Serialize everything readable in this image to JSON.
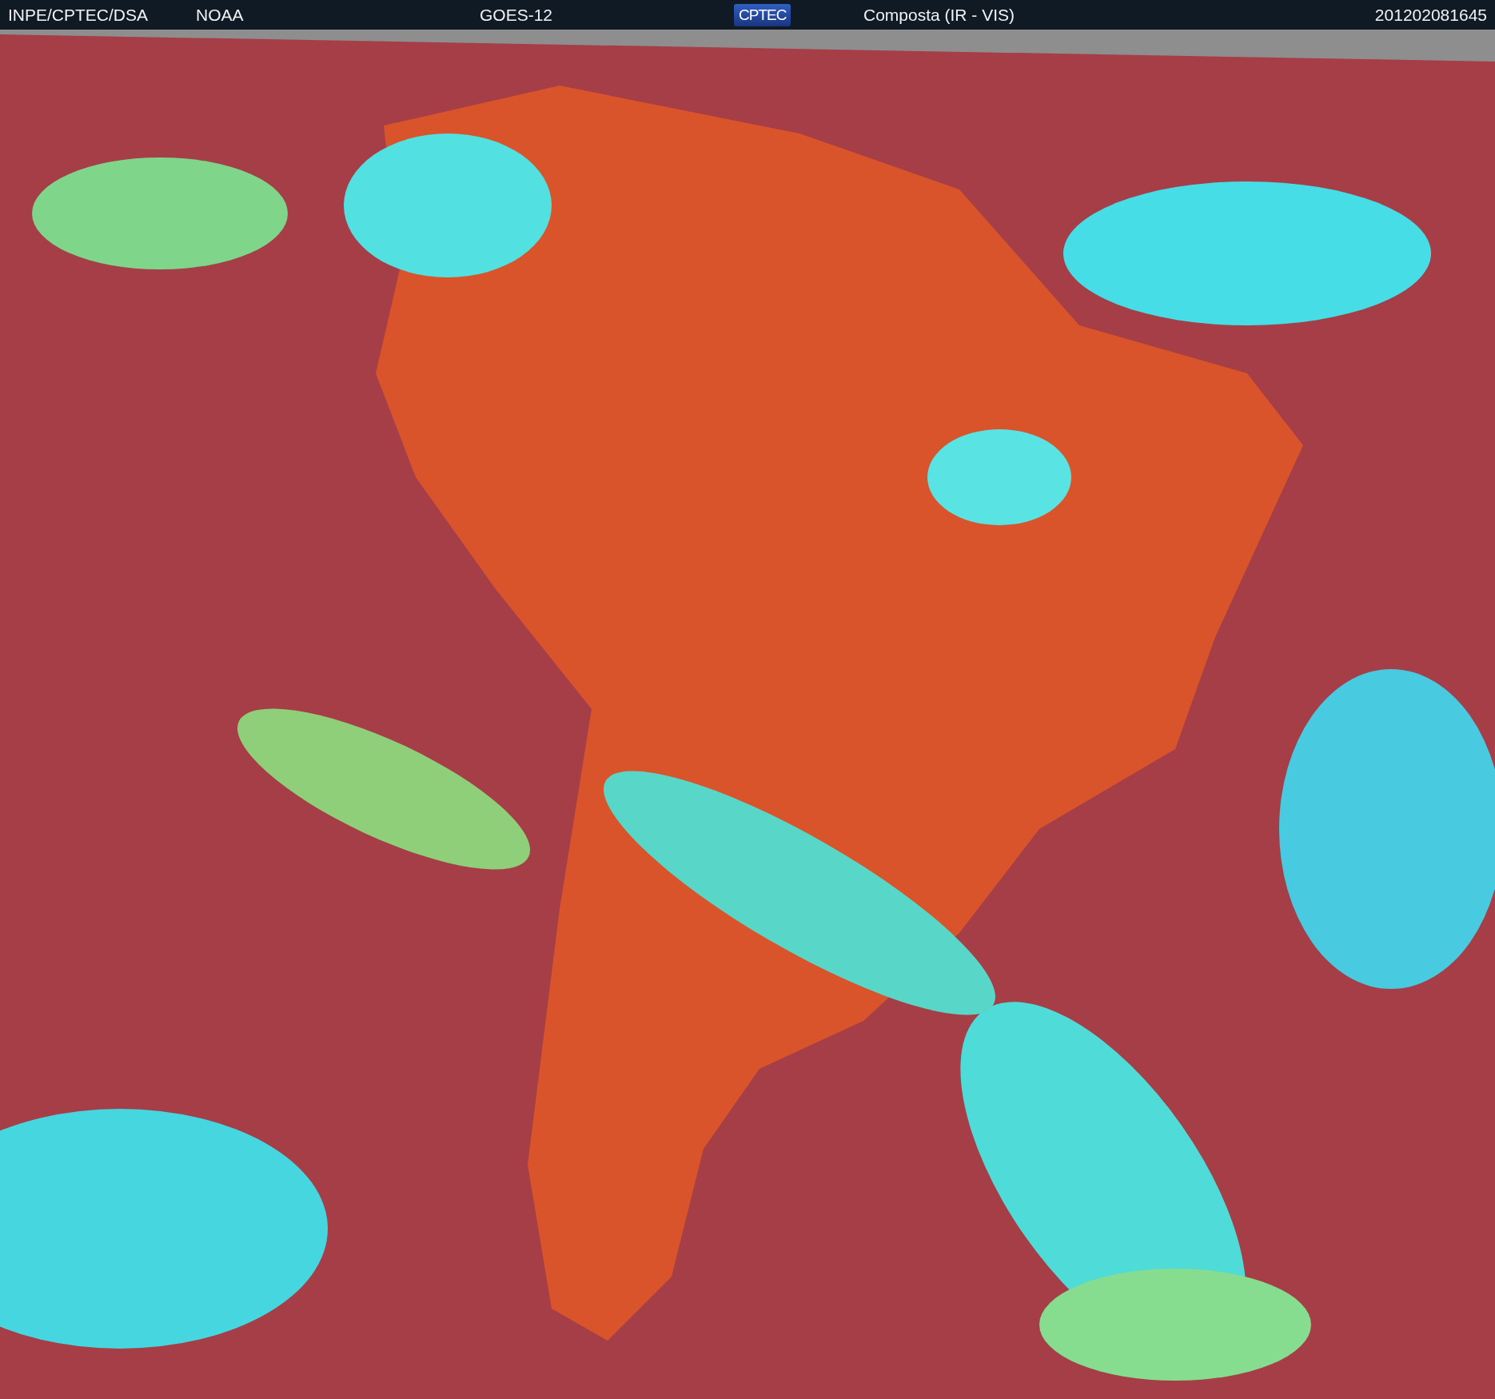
{
  "header": {
    "items": [
      {
        "kind": "text",
        "text": "INPE/CPTEC/DSA"
      },
      {
        "kind": "text",
        "text": "NOAA"
      },
      {
        "kind": "text",
        "text": "GOES-12"
      },
      {
        "kind": "logo",
        "text": "CPTEC"
      },
      {
        "kind": "text",
        "text": "Composta (IR - VIS)"
      },
      {
        "kind": "text",
        "text": "201202081645"
      }
    ]
  }
}
